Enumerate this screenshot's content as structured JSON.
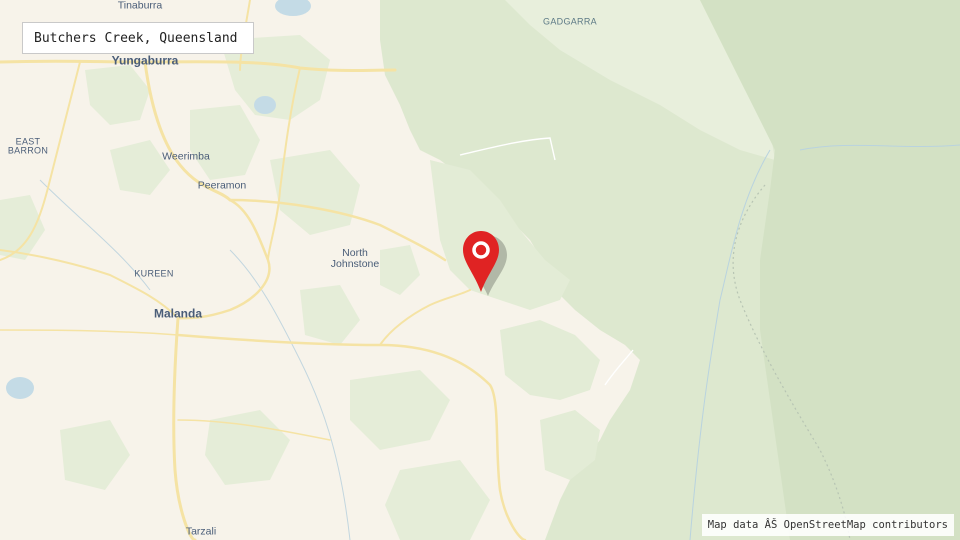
{
  "title_box": {
    "text": "Butchers Creek, Queensland"
  },
  "attribution": {
    "text": "Map data ÂŠ OpenStreetMap contributors"
  },
  "marker": {
    "icon": "map-pin-icon",
    "color": "#e02323"
  },
  "colors": {
    "background": "#f7f3ea",
    "forest_light": "#e8efdc",
    "forest_mid": "#dde8cf",
    "forest_dark": "#d3e1c4",
    "road": "#f7e6a9",
    "water": "#c4dbe6"
  },
  "places": {
    "tinaburra": "Tinaburra",
    "yungaburra": "Yungaburra",
    "east_barron_1": "EAST",
    "east_barron_2": "BARRON",
    "weerimba": "Weerimba",
    "peeramon": "Peeramon",
    "kureen": "KUREEN",
    "north_johnstone_1": "North",
    "north_johnstone_2": "Johnstone",
    "malanda": "Malanda",
    "tarzali": "Tarzali",
    "gadgarra": "GADGARRA"
  }
}
